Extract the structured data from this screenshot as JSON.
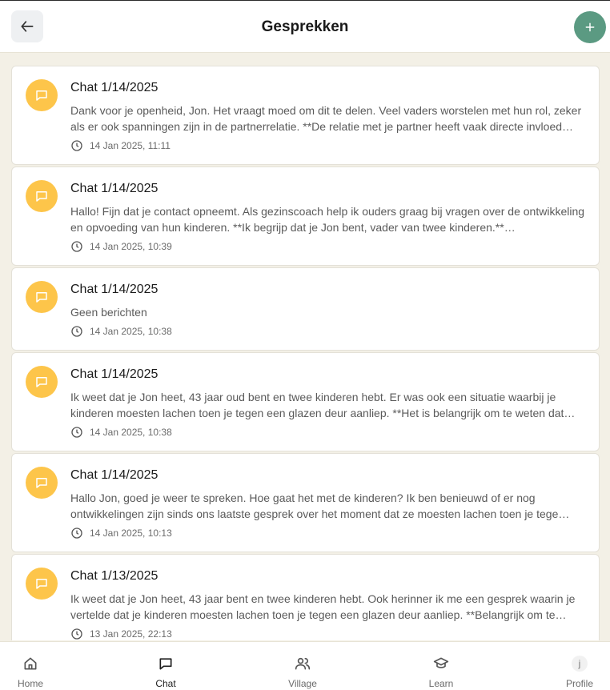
{
  "header": {
    "title": "Gesprekken",
    "back_icon": "arrow-left-icon",
    "add_icon": "plus-icon",
    "accent_color": "#5b9a82"
  },
  "conversations": [
    {
      "title": "Chat 1/14/2025",
      "preview": "Dank voor je openheid, Jon. Het vraagt moed om dit te delen. Veel vaders worstelen met hun rol, zeker als er ook spanningen zijn in de partnerrelatie. **De relatie met je partner heeft vaak directe invloed…",
      "timestamp": "14 Jan 2025, 11:11"
    },
    {
      "title": "Chat 1/14/2025",
      "preview": "Hallo! Fijn dat je contact opneemt. Als gezinscoach help ik ouders graag bij vragen over de ontwikkeling en opvoeding van hun kinderen. **Ik begrijp dat je Jon bent, vader van twee kinderen.**…",
      "timestamp": "14 Jan 2025, 10:39"
    },
    {
      "title": "Chat 1/14/2025",
      "preview": "Geen berichten",
      "timestamp": "14 Jan 2025, 10:38"
    },
    {
      "title": "Chat 1/14/2025",
      "preview": "Ik weet dat je Jon heet, 43 jaar oud bent en twee kinderen hebt. Er was ook een situatie waarbij je kinderen moesten lachen toen je tegen een glazen deur aanliep. **Het is belangrijk om te weten dat…",
      "timestamp": "14 Jan 2025, 10:38"
    },
    {
      "title": "Chat 1/14/2025",
      "preview": "Hallo Jon, goed je weer te spreken. Hoe gaat het met de kinderen? Ik ben benieuwd of er nog ontwikkelingen zijn sinds ons laatste gesprek over het moment dat ze moesten lachen toen je tege…",
      "timestamp": "14 Jan 2025, 10:13"
    },
    {
      "title": "Chat 1/13/2025",
      "preview": "Ik weet dat je Jon heet, 43 jaar bent en twee kinderen hebt. Ook herinner ik me een gesprek waarin je vertelde dat je kinderen moesten lachen toen je tegen een glazen deur aanliep. **Belangrijk om te…",
      "timestamp": "13 Jan 2025, 22:13"
    }
  ],
  "conversation_icon": "chat-bubble-icon",
  "conversation_icon_color": "#fdc54a",
  "time_icon": "clock-icon",
  "nav": [
    {
      "label": "Home",
      "icon": "home-icon"
    },
    {
      "label": "Chat",
      "icon": "chat-icon",
      "active": true
    },
    {
      "label": "Village",
      "icon": "users-icon"
    },
    {
      "label": "Learn",
      "icon": "graduation-cap-icon"
    },
    {
      "label": "Profile",
      "icon": "avatar-icon",
      "avatar_letter": "j"
    }
  ]
}
